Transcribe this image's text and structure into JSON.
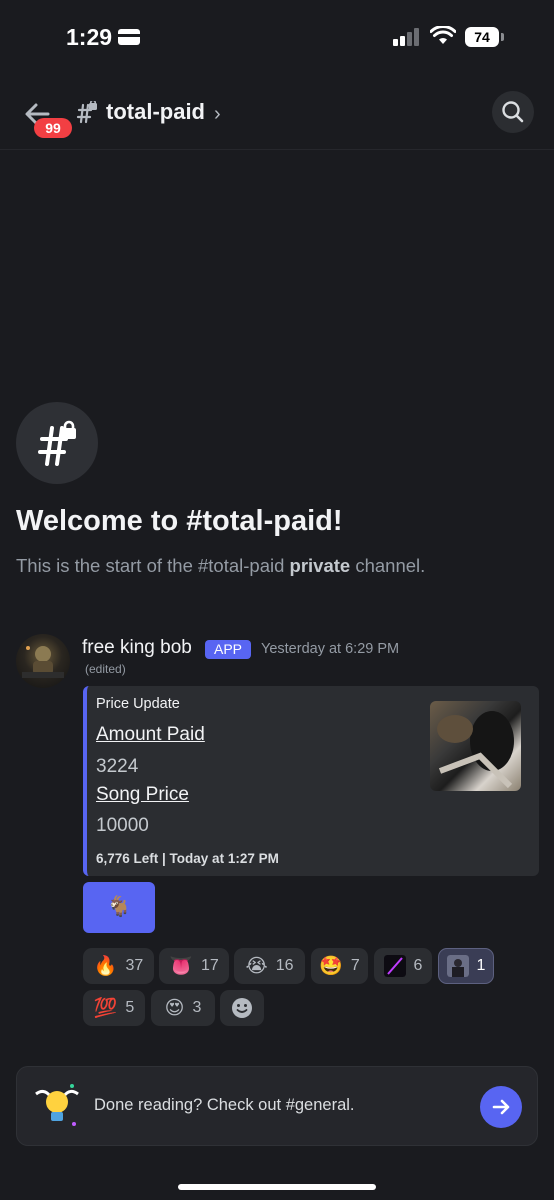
{
  "status_bar": {
    "time": "1:29",
    "battery": "74"
  },
  "header": {
    "badge_count": "99",
    "channel_name": "total-paid",
    "chevron": "›"
  },
  "welcome": {
    "title": "Welcome to #total-paid!",
    "subtitle_pre": "This is the start of the #total-paid ",
    "subtitle_bold": "private",
    "subtitle_post": " channel."
  },
  "message": {
    "author": "free king bob",
    "tag": "APP",
    "timestamp": "Yesterday at 6:29 PM",
    "edited": "(edited)",
    "embed": {
      "title": "Price Update",
      "fields": [
        {
          "name": "Amount Paid",
          "value": "3224"
        },
        {
          "name": "Song Price",
          "value": "10000"
        }
      ],
      "footer": "6,776 Left | Today at 1:27 PM"
    },
    "button_emoji": "🐐"
  },
  "reactions": [
    {
      "emoji": "🔥",
      "count": "37"
    },
    {
      "emoji": "👅",
      "count": "17"
    },
    {
      "emoji": "😭",
      "count": "16"
    },
    {
      "emoji": "🤩",
      "count": "7"
    },
    {
      "emoji": "custom-slash",
      "count": "6"
    },
    {
      "emoji": "custom-photo",
      "count": "1",
      "selected": true
    },
    {
      "emoji": "💯",
      "count": "5"
    },
    {
      "emoji": "😍",
      "count": "3"
    },
    {
      "emoji": "add-reaction",
      "count": ""
    }
  ],
  "banner": {
    "text": "Done reading? Check out #general."
  },
  "colors": {
    "accent": "#5865f2",
    "badge": "#f23f43",
    "background": "#1a1b1f"
  }
}
